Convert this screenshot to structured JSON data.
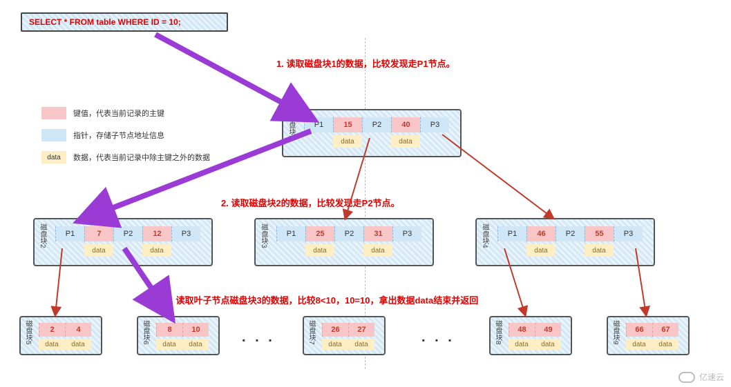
{
  "sql": "SELECT *  FROM table WHERE ID = 10;",
  "legend": {
    "key": "键值，代表当前记录的主键",
    "ptr": "指针，存储子节点地址信息",
    "data_label": "data",
    "data": "数据，代表当前记录中除主键之外的数据"
  },
  "annotations": {
    "step1": "1. 读取磁盘块1的数据，比较发现走P1节点。",
    "step2": "2. 读取磁盘块2的数据，比较发现走P2节点。",
    "step3": "3. 读取叶子节点磁盘块3的数据，比较8<10，10=10，拿出数据data结束并返回"
  },
  "colors": {
    "key_bg": "#f8c6c6",
    "ptr_bg": "#cfe6f7",
    "data_bg": "#fdeec4",
    "ann": "#e60000",
    "arrow_purple": "#9b3bd6",
    "arrow_red": "#c0392b"
  },
  "data_text": "data",
  "dots": ". . .",
  "watermark": "亿速云",
  "blocks": {
    "root": {
      "label": "磁盘块1",
      "cells": [
        "P1",
        "15",
        "P2",
        "40",
        "P3"
      ],
      "data_under": [
        1,
        3
      ]
    },
    "mid": [
      {
        "label": "磁盘块2",
        "cells": [
          "P1",
          "7",
          "P2",
          "12",
          "P3"
        ],
        "data_under": [
          1,
          3
        ]
      },
      {
        "label": "磁盘块3",
        "cells": [
          "P1",
          "25",
          "P2",
          "31",
          "P3"
        ],
        "data_under": [
          1,
          3
        ]
      },
      {
        "label": "磁盘块4",
        "cells": [
          "P1",
          "46",
          "P2",
          "55",
          "P3"
        ],
        "data_under": [
          1,
          3
        ]
      }
    ],
    "leaves": [
      {
        "label": "磁盘块5",
        "keys": [
          "2",
          "4"
        ]
      },
      {
        "label": "磁盘块6",
        "keys": [
          "8",
          "10"
        ]
      },
      {
        "label": "磁盘块7",
        "keys": [
          "26",
          "27"
        ]
      },
      {
        "label": "磁盘块8",
        "keys": [
          "48",
          "49"
        ]
      },
      {
        "label": "磁盘块9",
        "keys": [
          "66",
          "67"
        ]
      }
    ]
  }
}
